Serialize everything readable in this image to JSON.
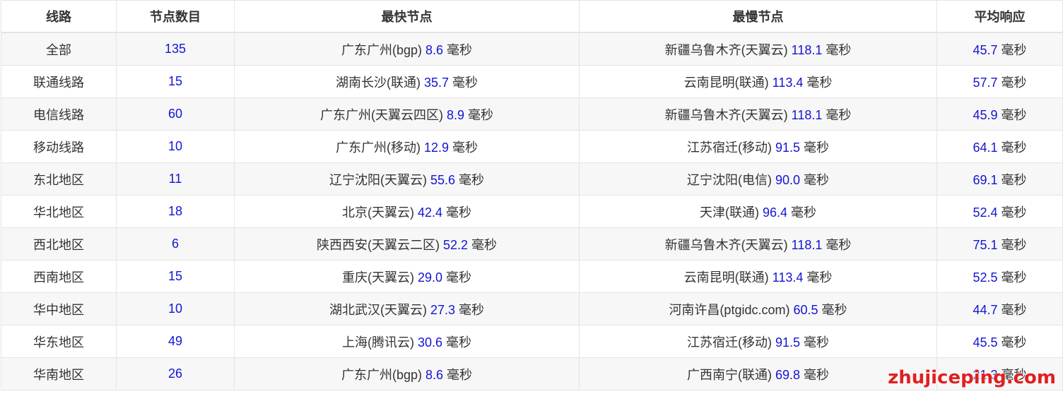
{
  "table": {
    "headers": [
      "线路",
      "节点数目",
      "最快节点",
      "最慢节点",
      "平均响应"
    ],
    "unit": "毫秒",
    "rows": [
      {
        "line": "全部",
        "count": "135",
        "fast_name": "广东广州(bgp)",
        "fast_ms": "8.6",
        "slow_name": "新疆乌鲁木齐(天翼云)",
        "slow_ms": "118.1",
        "avg_ms": "45.7"
      },
      {
        "line": "联通线路",
        "count": "15",
        "fast_name": "湖南长沙(联通)",
        "fast_ms": "35.7",
        "slow_name": "云南昆明(联通)",
        "slow_ms": "113.4",
        "avg_ms": "57.7"
      },
      {
        "line": "电信线路",
        "count": "60",
        "fast_name": "广东广州(天翼云四区)",
        "fast_ms": "8.9",
        "slow_name": "新疆乌鲁木齐(天翼云)",
        "slow_ms": "118.1",
        "avg_ms": "45.9"
      },
      {
        "line": "移动线路",
        "count": "10",
        "fast_name": "广东广州(移动)",
        "fast_ms": "12.9",
        "slow_name": "江苏宿迁(移动)",
        "slow_ms": "91.5",
        "avg_ms": "64.1"
      },
      {
        "line": "东北地区",
        "count": "11",
        "fast_name": "辽宁沈阳(天翼云)",
        "fast_ms": "55.6",
        "slow_name": "辽宁沈阳(电信)",
        "slow_ms": "90.0",
        "avg_ms": "69.1"
      },
      {
        "line": "华北地区",
        "count": "18",
        "fast_name": "北京(天翼云)",
        "fast_ms": "42.4",
        "slow_name": "天津(联通)",
        "slow_ms": "96.4",
        "avg_ms": "52.4"
      },
      {
        "line": "西北地区",
        "count": "6",
        "fast_name": "陕西西安(天翼云二区)",
        "fast_ms": "52.2",
        "slow_name": "新疆乌鲁木齐(天翼云)",
        "slow_ms": "118.1",
        "avg_ms": "75.1"
      },
      {
        "line": "西南地区",
        "count": "15",
        "fast_name": "重庆(天翼云)",
        "fast_ms": "29.0",
        "slow_name": "云南昆明(联通)",
        "slow_ms": "113.4",
        "avg_ms": "52.5"
      },
      {
        "line": "华中地区",
        "count": "10",
        "fast_name": "湖北武汉(天翼云)",
        "fast_ms": "27.3",
        "slow_name": "河南许昌(ptgidc.com)",
        "slow_ms": "60.5",
        "avg_ms": "44.7"
      },
      {
        "line": "华东地区",
        "count": "49",
        "fast_name": "上海(腾讯云)",
        "fast_ms": "30.6",
        "slow_name": "江苏宿迁(移动)",
        "slow_ms": "91.5",
        "avg_ms": "45.5"
      },
      {
        "line": "华南地区",
        "count": "26",
        "fast_name": "广东广州(bgp)",
        "fast_ms": "8.6",
        "slow_name": "广西南宁(联通)",
        "slow_ms": "69.8",
        "avg_ms": "21.3"
      }
    ]
  },
  "watermark": "zhujiceping.com",
  "colors": {
    "number": "#1414d6",
    "watermark": "#e02020",
    "stripe": "#f7f7f7",
    "border": "#e4e4e4"
  }
}
